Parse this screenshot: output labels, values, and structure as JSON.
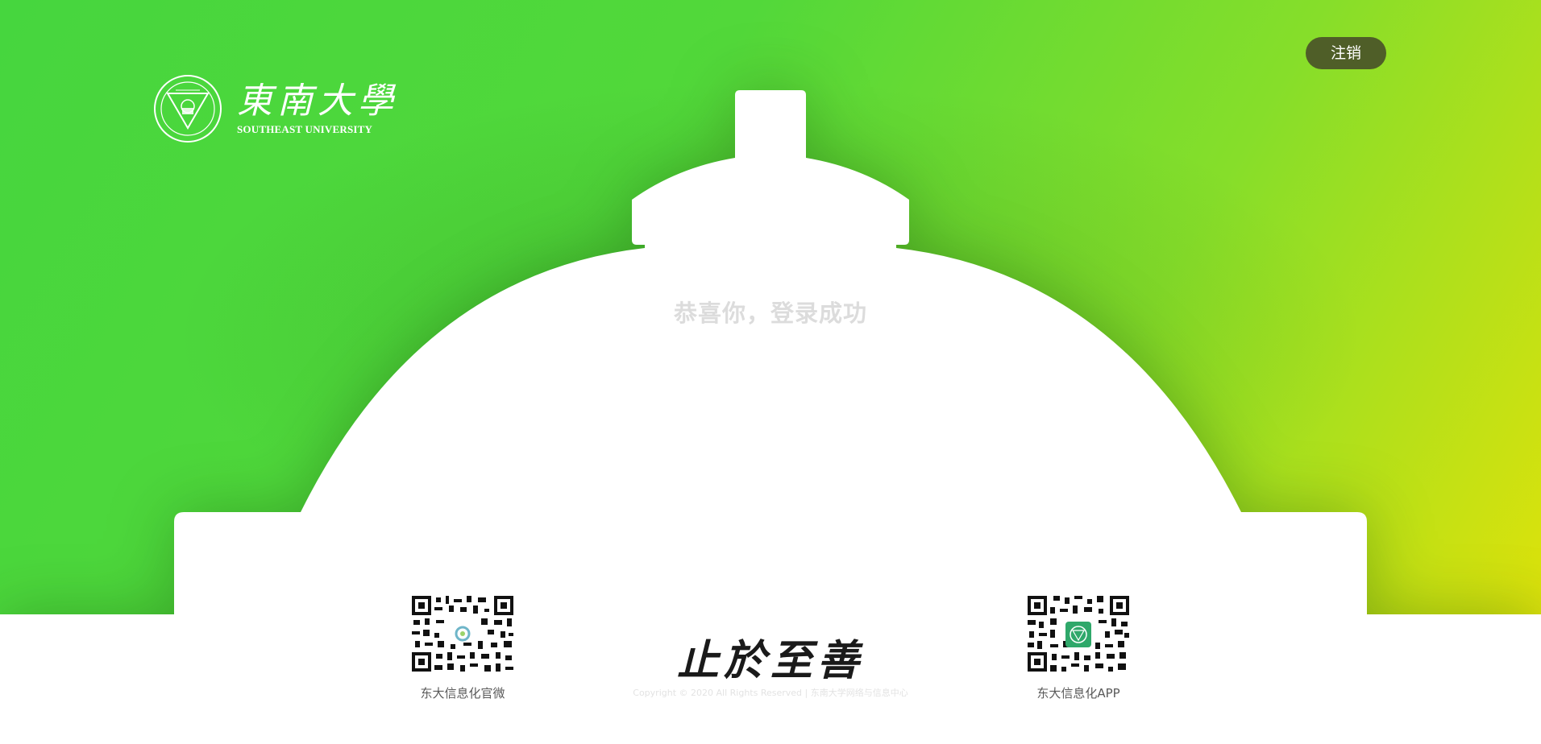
{
  "header": {
    "logo_cn": "東南大學",
    "logo_en": "SOUTHEAST UNIVERSITY",
    "logout_label": "注销"
  },
  "main": {
    "success_message": "恭喜你，登录成功"
  },
  "footer": {
    "qr_left_label": "东大信息化官微",
    "qr_right_label": "东大信息化APP",
    "motto": "止於至善",
    "copyright": "Copyright © 2020 All Rights Reserved | 东南大学网络与信息中心"
  },
  "colors": {
    "gradient_start": "#46d63e",
    "gradient_end": "#dde20b",
    "logout_bg": "#4f5e28"
  },
  "icons": {
    "seal": "university-seal-icon",
    "qr_left": "qr-code-icon",
    "qr_right": "qr-code-icon"
  }
}
